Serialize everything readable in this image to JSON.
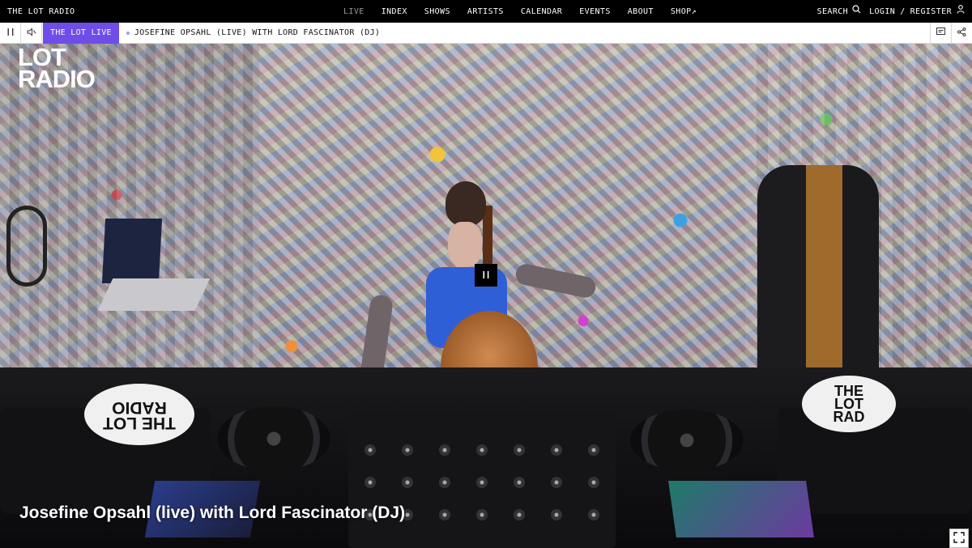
{
  "brand": {
    "name": "THE LOT RADIO"
  },
  "nav": {
    "items": [
      {
        "label": "LIVE",
        "active": true
      },
      {
        "label": "INDEX"
      },
      {
        "label": "SHOWS"
      },
      {
        "label": "ARTISTS"
      },
      {
        "label": "CALENDAR"
      },
      {
        "label": "EVENTS"
      },
      {
        "label": "ABOUT"
      },
      {
        "label": "SHOP↗"
      }
    ],
    "search_label": "SEARCH",
    "login_label": "LOGIN",
    "separator": "/",
    "register_label": "REGISTER"
  },
  "player": {
    "live_badge": "THE LOT LIVE",
    "now_playing": "JOSEFINE OPSAHL (LIVE) WITH LORD FASCINATOR (DJ)",
    "accent_color": "#6e4de8"
  },
  "video": {
    "logo_line1": "LOT",
    "logo_line2": "RADIO",
    "caption": "Josefine Opsahl (live) with Lord Fascinator (DJ)",
    "sticker_left": "THE LOT RADIO",
    "sticker_right_line1": "THE",
    "sticker_right_line2": "LOT",
    "sticker_right_line3": "RAD"
  },
  "icons": {
    "pause": "pause-icon",
    "volume": "volume-icon",
    "chat": "chat-icon",
    "share": "share-icon",
    "search": "search-icon",
    "user": "user-icon",
    "fullscreen": "fullscreen-icon"
  }
}
